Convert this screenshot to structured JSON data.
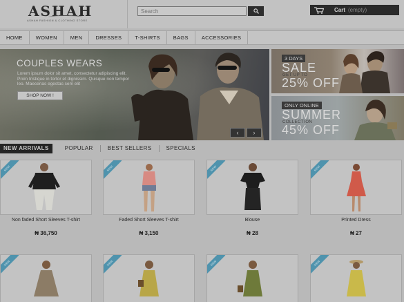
{
  "header": {
    "logo": "ASHAH",
    "logo_tagline": "ASHAH FASHION & CLOTHING STORE",
    "search_placeholder": "Search",
    "cart_label": "Cart",
    "cart_status": "(empty)"
  },
  "nav": {
    "items": [
      "HOME",
      "WOMEN",
      "MEN",
      "DRESSES",
      "T-SHIRTS",
      "BAGS",
      "ACCESSORIES"
    ]
  },
  "hero": {
    "title": "COUPLES WEARS",
    "text": "Lorem ipsum dolor sit amet, consectetur adipiscing elit. Proin tristique in tortor et dignissim. Quisque non tempor leo. Maecenas egestas sem elit",
    "button": "SHOP NOW !",
    "prev": "‹",
    "next": "›"
  },
  "promos": [
    {
      "tag": "3 DAYS",
      "line1": "SALE",
      "small": "GET UP TO",
      "line2": "25% OFF"
    },
    {
      "tag": "ONLY ONLINE",
      "line1": "SUMMER",
      "small": "COLLECTION",
      "line2": "45% OFF"
    }
  ],
  "tabs": [
    "NEW ARRIVALS",
    "POPULAR",
    "BEST SELLERS",
    "SPECIALS"
  ],
  "ribbon": "NEW",
  "products": [
    {
      "name": "Non faded Short Sleeves T-shirt",
      "price": "₦ 36,750"
    },
    {
      "name": "Faded Short Sleeves T-shirt",
      "price": "₦ 3,150"
    },
    {
      "name": "Blouse",
      "price": "₦ 28"
    },
    {
      "name": "Printed Dress",
      "price": "₦ 27"
    }
  ],
  "colors": {
    "ribbon": "#4f93ad",
    "dark": "#242424",
    "background": "#b9b9b9"
  }
}
